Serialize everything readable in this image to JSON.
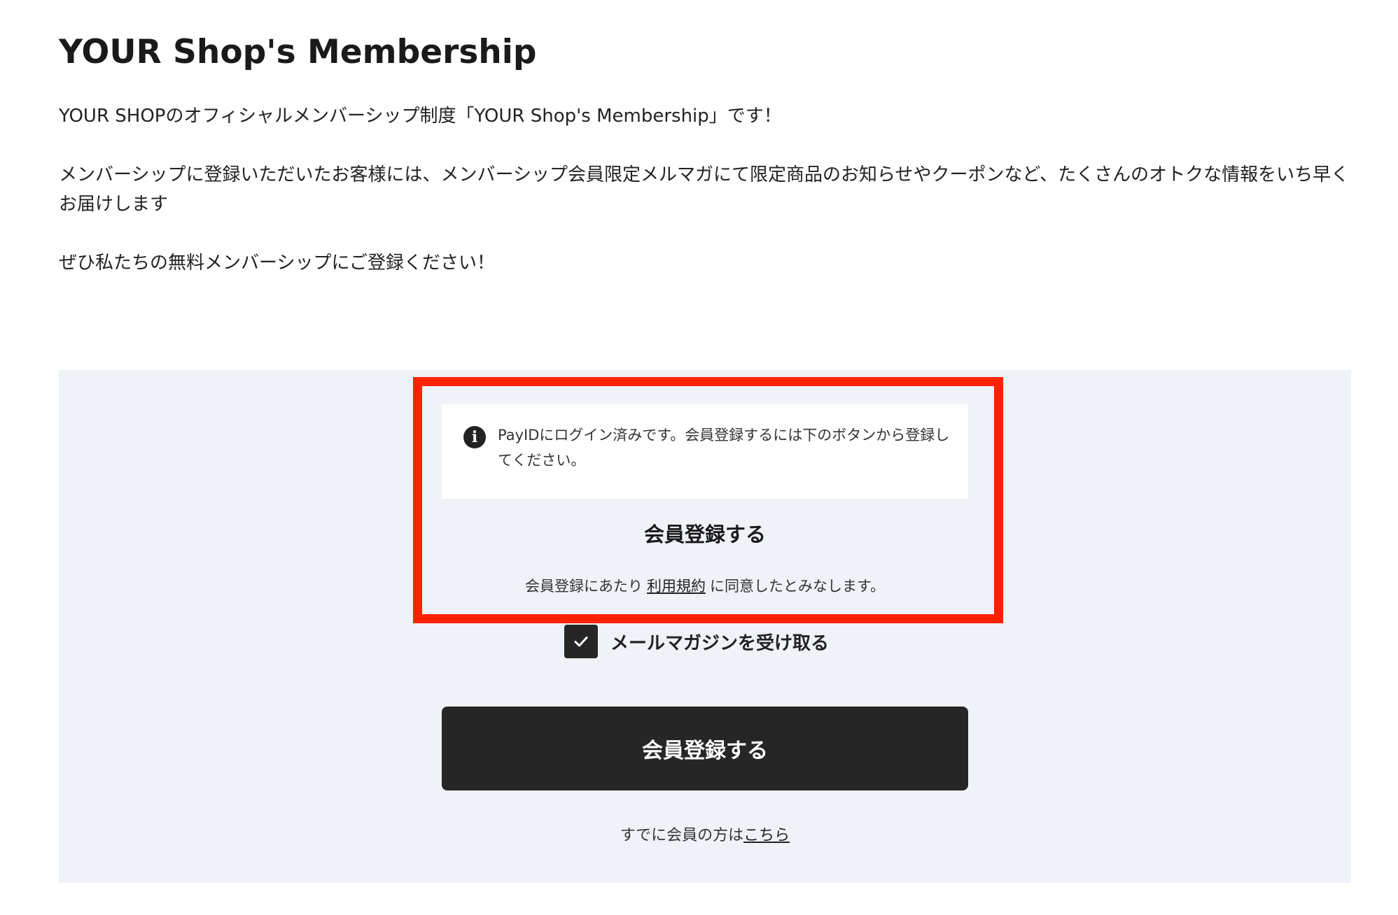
{
  "page": {
    "title": "YOUR Shop's Membership"
  },
  "intro": {
    "paragraph1": "YOUR SHOPのオフィシャルメンバーシップ制度「YOUR Shop's Membership」です！",
    "paragraph2": "メンバーシップに登録いただいたお客様には、メンバーシップ会員限定メルマガにて限定商品のお知らせやクーポンなど、たくさんのオトクな情報をいち早くお届けします",
    "paragraph3": "ぜひ私たちの無料メンバーシップにご登録ください！"
  },
  "notice": {
    "icon": "info-icon",
    "icon_glyph": "i",
    "text": "PayIDにログイン済みです。会員登録するには下のボタンから登録してください。"
  },
  "register_section": {
    "heading": "会員登録する",
    "terms_prefix": "会員登録にあたり",
    "terms_link": "利用規約",
    "terms_suffix": "に同意したとみなします。"
  },
  "mail_magazine": {
    "checked": true,
    "label": "メールマガジンを受け取る"
  },
  "submit_button": {
    "label": "会員登録する"
  },
  "existing_member": {
    "prefix": "すでに会員の方は",
    "link": "こちら"
  },
  "colors": {
    "panel_background": "#eff2f7",
    "highlight_border": "#ff2200",
    "button_background": "#262626",
    "text": "#222222"
  }
}
